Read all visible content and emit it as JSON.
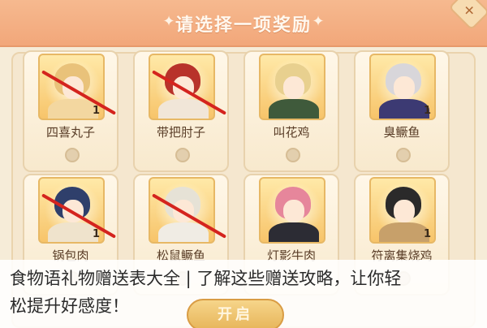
{
  "dialog": {
    "title": "请选择一项奖励",
    "ornament_left": "✦",
    "ornament_right": "✦",
    "close_symbol": "✕"
  },
  "rewards": [
    {
      "name": "四喜丸子",
      "quantity": "1",
      "crossed": true,
      "hair": "#e9c27a",
      "outfit": "#f3d7a0"
    },
    {
      "name": "带把肘子",
      "quantity": "",
      "crossed": true,
      "hair": "#b8322a",
      "outfit": "#f1e6d8"
    },
    {
      "name": "叫花鸡",
      "quantity": "",
      "crossed": false,
      "hair": "#e8d08f",
      "outfit": "#3f5a3b"
    },
    {
      "name": "臭鳜鱼",
      "quantity": "1",
      "crossed": false,
      "hair": "#d8d6da",
      "outfit": "#3c3a73"
    },
    {
      "name": "锅包肉",
      "quantity": "1",
      "crossed": true,
      "hair": "#2f3f6b",
      "outfit": "#efe3cc"
    },
    {
      "name": "松鼠鳜鱼",
      "quantity": "",
      "crossed": true,
      "hair": "#e6e2d6",
      "outfit": "#f0ece4"
    },
    {
      "name": "灯影牛肉",
      "quantity": "",
      "crossed": false,
      "hair": "#e6869b",
      "outfit": "#2c2c34"
    },
    {
      "name": "符离集烧鸡",
      "quantity": "1",
      "crossed": false,
      "hair": "#2b2a2a",
      "outfit": "#c7a06a"
    }
  ],
  "open_button": "开启",
  "caption": {
    "line1": "食物语礼物赠送表大全 | 了解这些赠送攻略，让你轻",
    "line2": "松提升好感度！"
  },
  "colors": {
    "header": "#f2a77a",
    "panel": "#f5e7cf",
    "slash": "#d4241e"
  }
}
